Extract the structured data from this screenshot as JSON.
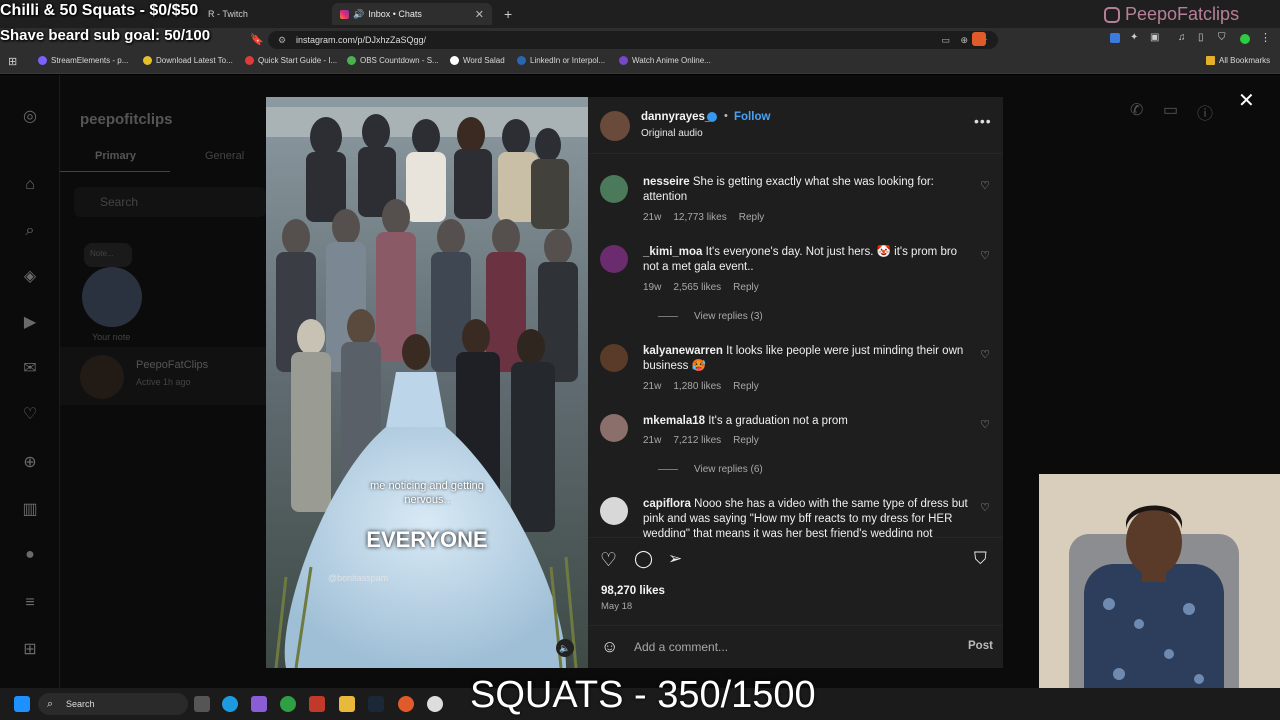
{
  "browser": {
    "tabs": [
      {
        "label": "R - Twitch"
      },
      {
        "label": "Inbox • Chats"
      }
    ],
    "new_tab": "+",
    "url": "instagram.com/p/DJxhzZaSQgg/",
    "bookmarks": [
      {
        "label": "StreamElements - p...",
        "color": "#7b61ff"
      },
      {
        "label": "Download Latest To...",
        "color": "#e4c02a"
      },
      {
        "label": "Quick Start Guide - I...",
        "color": "#e03b3b"
      },
      {
        "label": "OBS Countdown - S...",
        "color": "#4caf50"
      },
      {
        "label": "Word Salad",
        "color": "#ffffff"
      },
      {
        "label": "LinkedIn or Interpol...",
        "color": "#2867b2"
      },
      {
        "label": "Watch Anime Online...",
        "color": "#7a46c9"
      }
    ],
    "all_bookmarks": "All Bookmarks"
  },
  "stream": {
    "goal1": "Chilli & 50 Squats - $0/$50",
    "goal2": "Shave beard sub goal: 50/100",
    "channel": "PeepoFatclips",
    "squats": "SQUATS - 350/1500"
  },
  "instagram_bg": {
    "account": "peepofitclips",
    "tab_primary": "Primary",
    "tab_general": "General",
    "search_placeholder": "Search",
    "note_label": "Note...",
    "your_note": "Your note",
    "chat_name": "PeepoFatClips",
    "chat_status": "Active 1h ago"
  },
  "post": {
    "author": "dannyrayes_",
    "follow": "Follow",
    "audio": "Original audio",
    "video_caption": "me noticing and getting nervous..",
    "video_title": "EVERYONE",
    "video_handle": "@bonitasspam",
    "likes": "98,270 likes",
    "date": "May 18",
    "add_comment": "Add a comment...",
    "post_button": "Post",
    "comments": [
      {
        "user": "nesseire",
        "text": "She is getting exactly what she was looking for: attention",
        "age": "21w",
        "likes": "12,773 likes",
        "reply": "Reply",
        "avatar_color": "#4a7a5a"
      },
      {
        "user": "_kimi_moa",
        "text": "It's everyone's day. Not just hers. 🤡 it's prom bro not a met gala event..",
        "age": "19w",
        "likes": "2,565 likes",
        "reply": "Reply",
        "view_replies": "View replies (3)",
        "avatar_color": "#6b2c6f"
      },
      {
        "user": "kalyanewarren",
        "text": "It looks like people were just minding their own business 🥵",
        "age": "21w",
        "likes": "1,280 likes",
        "reply": "Reply",
        "avatar_color": "#5a3b2a"
      },
      {
        "user": "mkemala18",
        "text": "It's a graduation not a prom",
        "age": "21w",
        "likes": "7,212 likes",
        "reply": "Reply",
        "view_replies": "View replies (6)",
        "avatar_color": "#8a6f6a"
      },
      {
        "user": "capiflora",
        "text": "Nooo she has a video with the same type of dress but pink and was saying \"How my bff reacts to my dress for HER wedding\" that means it was her best friend's wedding not",
        "avatar_color": "#d8d8d8"
      }
    ]
  },
  "taskbar": {
    "search": "Search"
  }
}
